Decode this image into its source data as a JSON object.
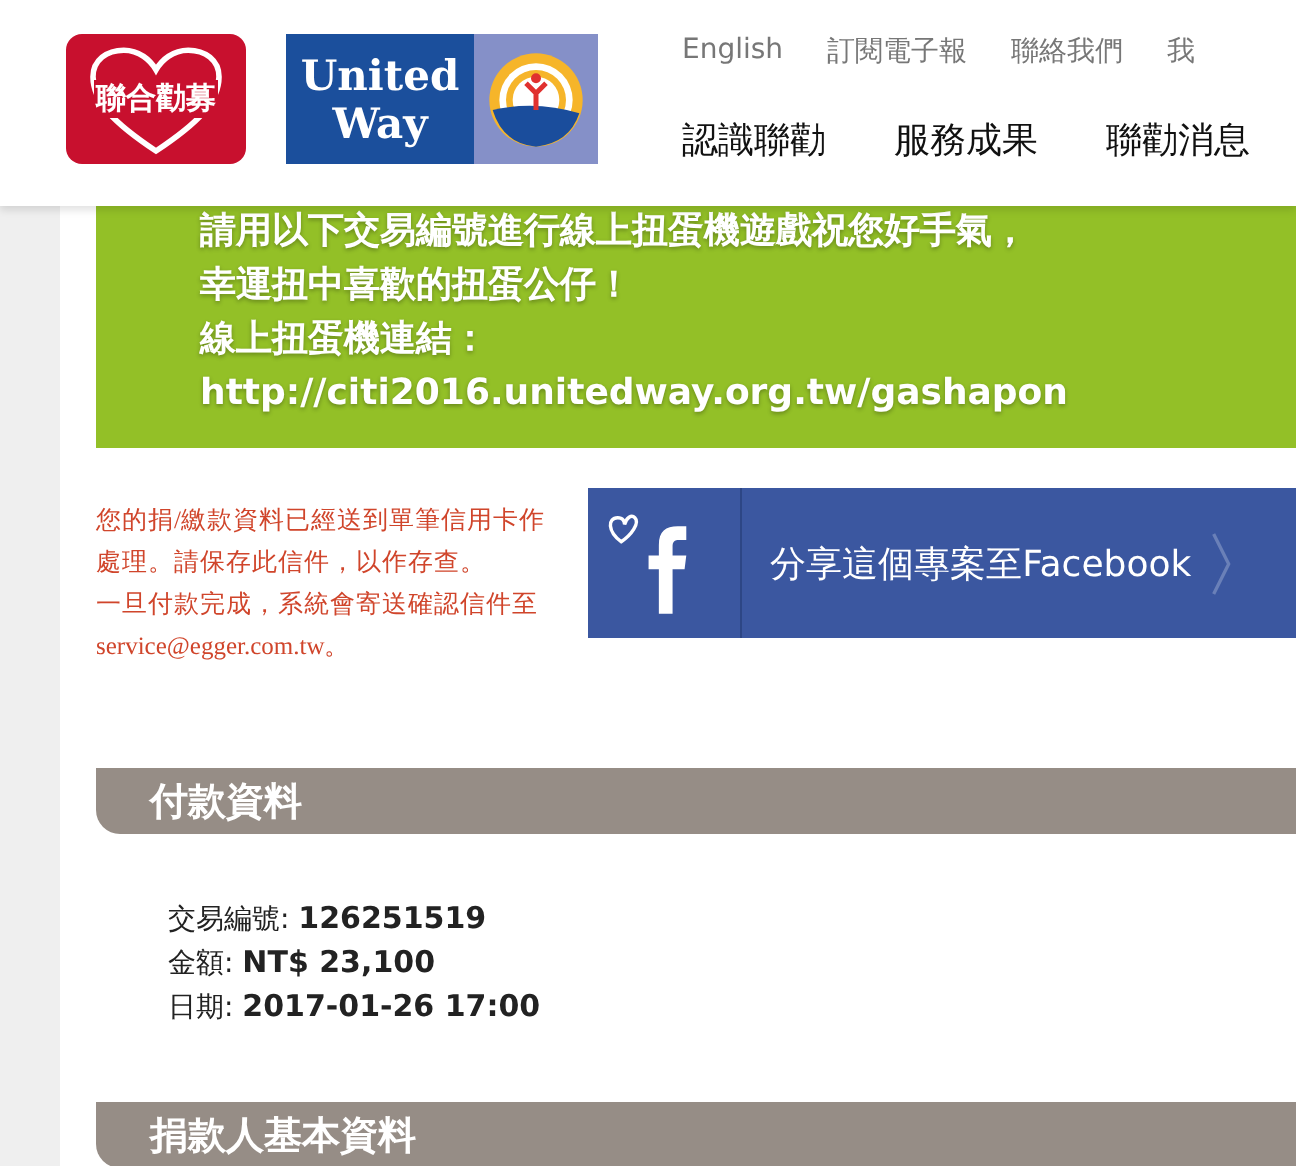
{
  "header": {
    "logo_left": "聯合勸募",
    "logo_right": [
      "United",
      "Way"
    ],
    "top_links": [
      "English",
      "訂閱電子報",
      "聯絡我們",
      "我"
    ],
    "nav": [
      "認識聯勸",
      "服務成果",
      "聯勸消息"
    ]
  },
  "notice": {
    "lines": [
      "請用以下交易編號進行線上扭蛋機遊戲祝您好手氣，",
      "幸運扭中喜歡的扭蛋公仔！",
      "線上扭蛋機連結："
    ],
    "link": "http://citi2016.unitedway.org.tw/gashapon"
  },
  "message": [
    "您的捐/繳款資料已經送到單筆信用卡作處理。請保存此信件，以作存查。",
    "一旦付款完成，系統會寄送確認信件至service@egger.com.tw。"
  ],
  "share_button": "分享這個專案至Facebook",
  "payment": {
    "title": "付款資料",
    "fields": [
      {
        "label": "交易編號:",
        "value": "126251519"
      },
      {
        "label": "金額:",
        "value": "NT$ 23,100"
      },
      {
        "label": "日期:",
        "value": "2017-01-26 17:00"
      }
    ]
  },
  "donor": {
    "title": "捐款人基本資料"
  }
}
